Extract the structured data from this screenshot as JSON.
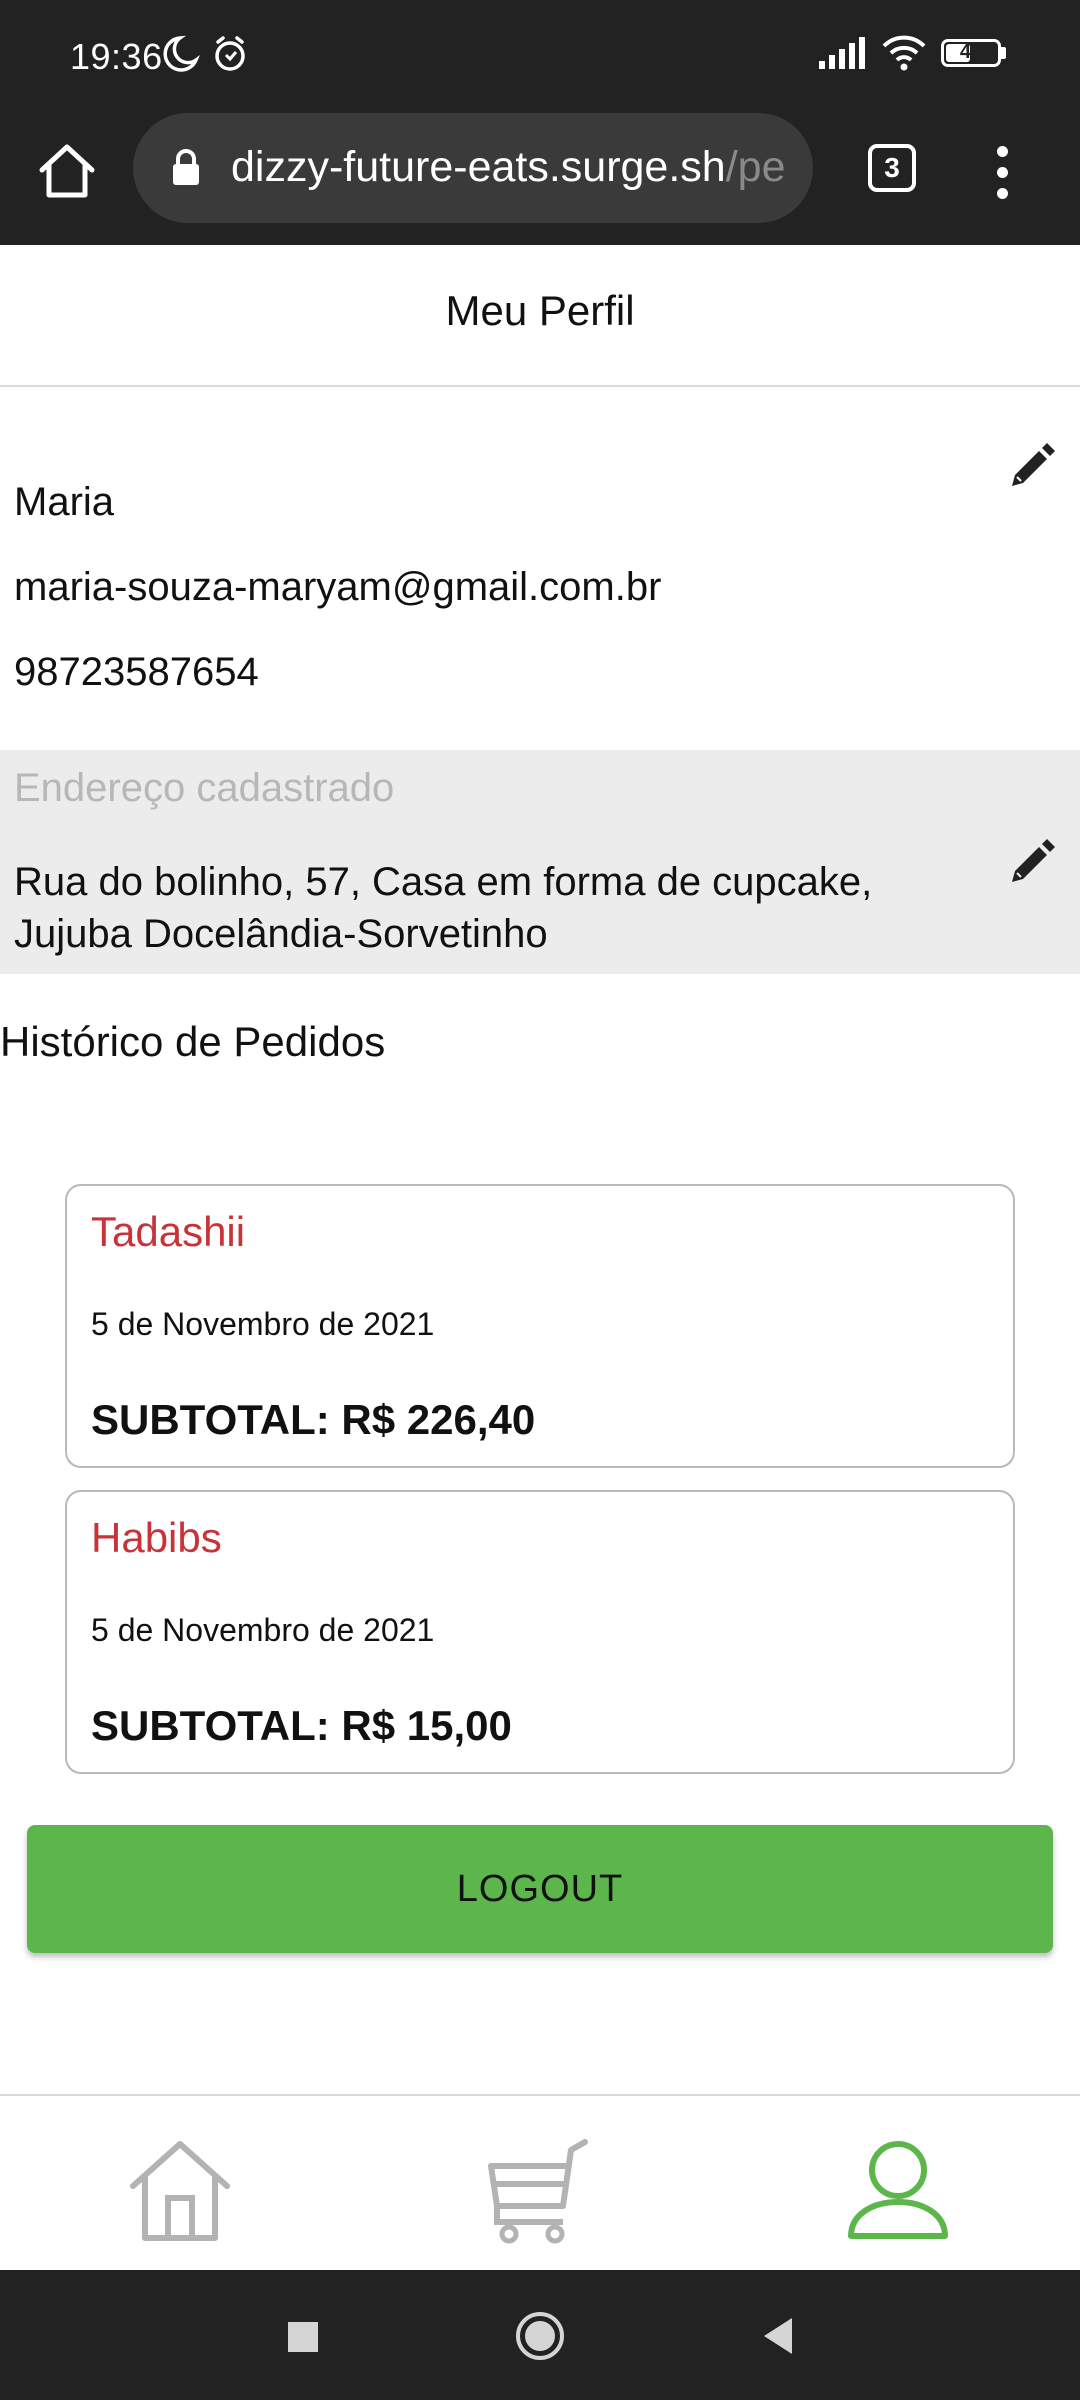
{
  "status_bar": {
    "time": "19:36",
    "battery": "48",
    "icons": [
      "moon-icon",
      "alarm-icon",
      "signal-icon",
      "wifi-icon",
      "battery-icon"
    ]
  },
  "browser": {
    "url_main": "dizzy-future-eats.surge.sh",
    "url_tail": "/pe",
    "tab_count": "3",
    "icons": [
      "home-icon",
      "lock-icon",
      "more-vert-icon"
    ]
  },
  "header": {
    "title": "Meu Perfil"
  },
  "profile": {
    "name": "Maria",
    "email": "maria-souza-maryam@gmail.com.br",
    "phone": "98723587654",
    "edit_icon": "pencil-icon"
  },
  "address": {
    "label": "Endereço cadastrado",
    "line1": "Rua do bolinho, 57, Casa em forma de cupcake,",
    "line2": "Jujuba Docelândia-Sorvetinho",
    "edit_icon": "pencil-icon"
  },
  "history": {
    "title": "Histórico de Pedidos",
    "orders": [
      {
        "restaurant": "Tadashii",
        "date": "5 de Novembro de 2021",
        "subtotal": "SUBTOTAL: R$ 226,40"
      },
      {
        "restaurant": "Habibs",
        "date": "5 de Novembro de 2021",
        "subtotal": "SUBTOTAL: R$ 15,00"
      }
    ]
  },
  "logout": {
    "label": "LOGOUT"
  },
  "bottom_nav": {
    "items": [
      {
        "icon": "home-icon",
        "active": false
      },
      {
        "icon": "cart-icon",
        "active": false
      },
      {
        "icon": "user-icon",
        "active": true
      }
    ]
  },
  "colors": {
    "accent_green": "#5cb64c",
    "restaurant_red": "#c8333a",
    "dark_bar": "#222222",
    "nav_inactive": "#b3b3b3"
  }
}
